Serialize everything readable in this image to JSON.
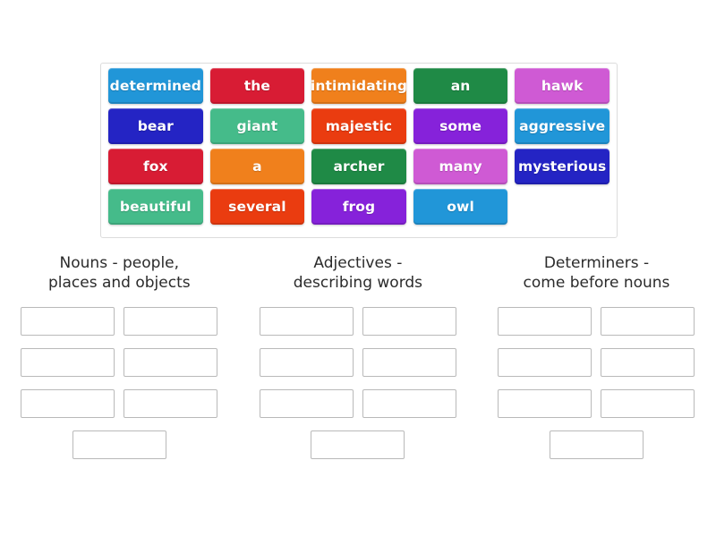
{
  "activity": {
    "type": "group-sort",
    "word_bank": {
      "rows": [
        [
          {
            "label": "determined",
            "color": "#2196d8"
          },
          {
            "label": "the",
            "color": "#d81c34"
          },
          {
            "label": "intimidating",
            "color": "#f0801c"
          },
          {
            "label": "an",
            "color": "#1f8a46"
          },
          {
            "label": "hawk",
            "color": "#cf5ad4"
          }
        ],
        [
          {
            "label": "bear",
            "color": "#2424c4"
          },
          {
            "label": "giant",
            "color": "#45bb8a"
          },
          {
            "label": "majestic",
            "color": "#ea3c10"
          },
          {
            "label": "some",
            "color": "#8622da"
          },
          {
            "label": "aggressive",
            "color": "#2196d8"
          }
        ],
        [
          {
            "label": "fox",
            "color": "#d81c34"
          },
          {
            "label": "a",
            "color": "#f0801c"
          },
          {
            "label": "archer",
            "color": "#1f8a46"
          },
          {
            "label": "many",
            "color": "#cf5ad4"
          },
          {
            "label": "mysterious",
            "color": "#2424c4"
          }
        ],
        [
          {
            "label": "beautiful",
            "color": "#45bb8a"
          },
          {
            "label": "several",
            "color": "#ea3c10"
          },
          {
            "label": "frog",
            "color": "#8622da"
          },
          {
            "label": "owl",
            "color": "#2196d8"
          },
          {
            "label": "",
            "color": "transparent"
          }
        ]
      ]
    },
    "columns": [
      {
        "title_line1": "Nouns - people,",
        "title_line2": "places and objects",
        "slot_count": 7,
        "slots": [
          "",
          "",
          "",
          "",
          "",
          "",
          ""
        ]
      },
      {
        "title_line1": "Adjectives -",
        "title_line2": "describing words",
        "slot_count": 7,
        "slots": [
          "",
          "",
          "",
          "",
          "",
          "",
          ""
        ]
      },
      {
        "title_line1": "Determiners -",
        "title_line2": "come before nouns",
        "slot_count": 7,
        "slots": [
          "",
          "",
          "",
          "",
          "",
          "",
          ""
        ]
      }
    ]
  }
}
